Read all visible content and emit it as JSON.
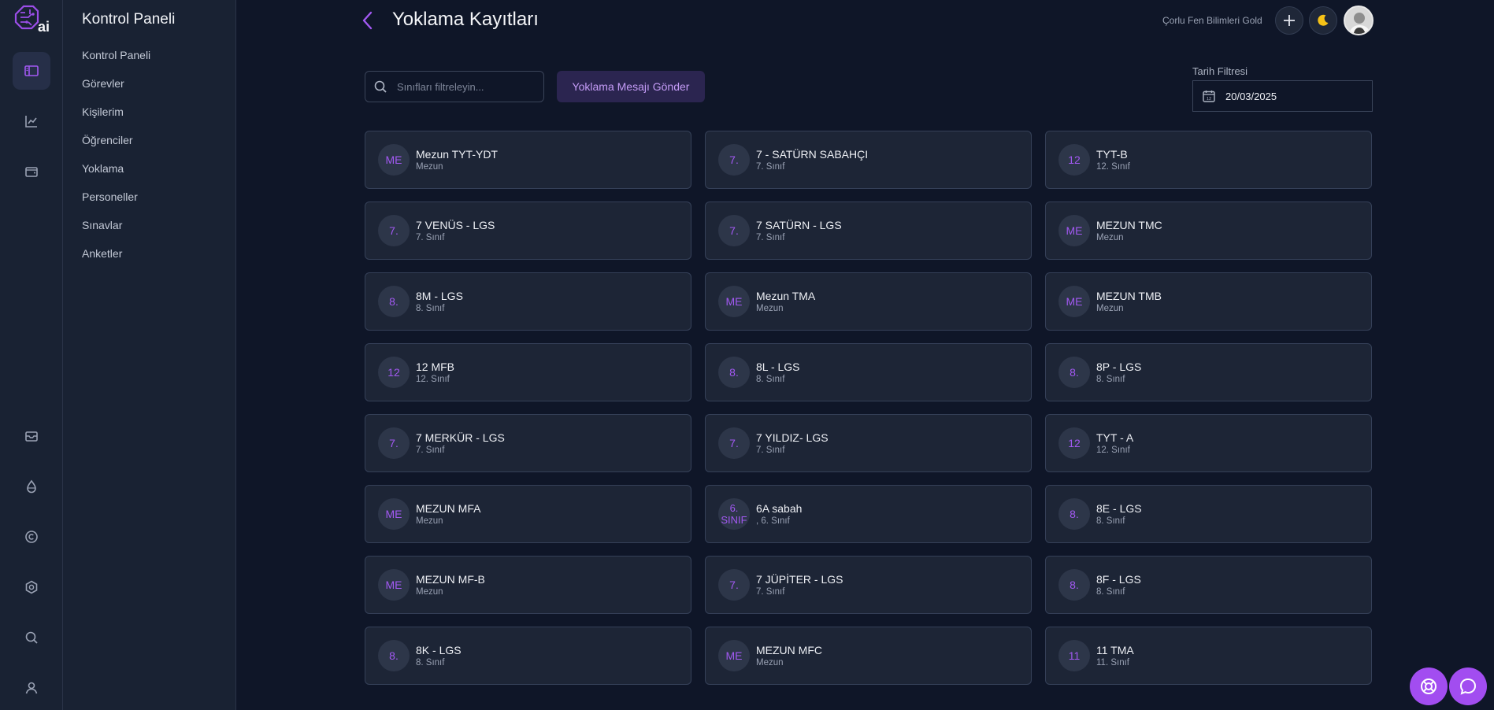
{
  "app": {
    "logo_text": "ai"
  },
  "sidebar": {
    "title": "Kontrol Paneli",
    "items": [
      {
        "label": "Kontrol Paneli"
      },
      {
        "label": "Görevler"
      },
      {
        "label": "Kişilerim"
      },
      {
        "label": "Öğrenciler"
      },
      {
        "label": "Yoklama"
      },
      {
        "label": "Personeller"
      },
      {
        "label": "Sınavlar"
      },
      {
        "label": "Anketler"
      }
    ]
  },
  "rail_icons": [
    "sidebar-icon",
    "chart-icon",
    "wallet-icon",
    "mail-icon",
    "drop-icon",
    "copyright-icon",
    "settings-icon",
    "search-icon",
    "user-icon"
  ],
  "header": {
    "title": "Yoklama Kayıtları",
    "school_name": "Çorlu Fen Bilimleri Gold"
  },
  "toolbar": {
    "search_placeholder": "Sınıfları filtreleyin...",
    "send_button": "Yoklama Mesajı Gönder",
    "date_filter_label": "Tarih Filtresi",
    "date_value": "20/03/2025"
  },
  "classes": [
    {
      "badge": "ME",
      "name": "Mezun TYT-YDT",
      "level": "Mezun"
    },
    {
      "badge": "7.",
      "name": "7 - SATÜRN SABAHÇI",
      "level": "7. Sınıf"
    },
    {
      "badge": "12",
      "name": "TYT-B",
      "level": "12. Sınıf"
    },
    {
      "badge": "7.",
      "name": "7 VENÜS - LGS",
      "level": "7. Sınıf"
    },
    {
      "badge": "7.",
      "name": "7 SATÜRN - LGS",
      "level": "7. Sınıf"
    },
    {
      "badge": "ME",
      "name": "MEZUN TMC",
      "level": "Mezun"
    },
    {
      "badge": "8.",
      "name": "8M - LGS",
      "level": "8. Sınıf"
    },
    {
      "badge": "ME",
      "name": "Mezun TMA",
      "level": "Mezun"
    },
    {
      "badge": "ME",
      "name": "MEZUN TMB",
      "level": "Mezun"
    },
    {
      "badge": "12",
      "name": "12 MFB",
      "level": "12. Sınıf"
    },
    {
      "badge": "8.",
      "name": "8L - LGS",
      "level": "8. Sınıf"
    },
    {
      "badge": "8.",
      "name": "8P - LGS",
      "level": "8. Sınıf"
    },
    {
      "badge": "7.",
      "name": "7 MERKÜR - LGS",
      "level": "7. Sınıf"
    },
    {
      "badge": "7.",
      "name": "7 YILDIZ- LGS",
      "level": "7. Sınıf"
    },
    {
      "badge": "12",
      "name": "TYT - A",
      "level": "12. Sınıf"
    },
    {
      "badge": "ME",
      "name": "MEZUN MFA",
      "level": "Mezun"
    },
    {
      "badge": "6. SINIF",
      "name": "6A sabah",
      "level": ", 6. Sınıf"
    },
    {
      "badge": "8.",
      "name": "8E - LGS",
      "level": "8. Sınıf"
    },
    {
      "badge": "ME",
      "name": "MEZUN MF-B",
      "level": "Mezun"
    },
    {
      "badge": "7.",
      "name": "7 JÜPİTER - LGS",
      "level": "7. Sınıf"
    },
    {
      "badge": "8.",
      "name": "8F - LGS",
      "level": "8. Sınıf"
    },
    {
      "badge": "8.",
      "name": "8K - LGS",
      "level": "8. Sınıf"
    },
    {
      "badge": "ME",
      "name": "MEZUN MFC",
      "level": "Mezun"
    },
    {
      "badge": "11",
      "name": "11 TMA",
      "level": "11. Sınıf"
    }
  ],
  "colors": {
    "accent": "#a24df0",
    "background": "#0f1628",
    "card": "#1d2536"
  }
}
